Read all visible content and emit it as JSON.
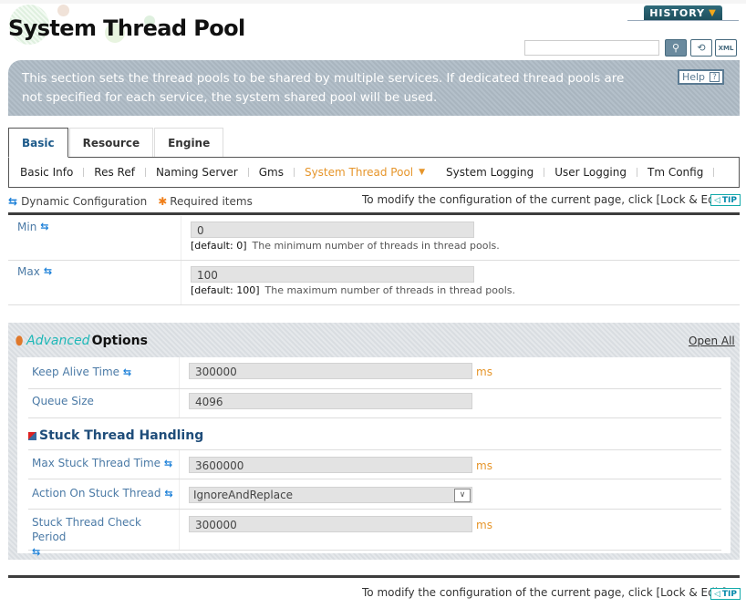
{
  "header": {
    "title": "System Thread Pool",
    "history_label": "HISTORY",
    "search_placeholder": "",
    "search_icon": "search-icon",
    "refresh_icon": "refresh-icon",
    "xml_icon": "xml-export-icon",
    "xml_label": "XML"
  },
  "banner": {
    "text": "This section sets the thread pools to be shared by multiple services. If dedicated thread pools are not specified for each service, the system shared pool will be used.",
    "help_label": "Help",
    "help_glyph": "?"
  },
  "tabs": [
    {
      "label": "Basic",
      "active": true
    },
    {
      "label": "Resource",
      "active": false
    },
    {
      "label": "Engine",
      "active": false
    }
  ],
  "subnav": [
    {
      "label": "Basic Info"
    },
    {
      "label": "Res Ref"
    },
    {
      "label": "Naming Server"
    },
    {
      "label": "Gms"
    },
    {
      "label": "System Thread Pool",
      "active": true
    },
    {
      "label": "System Logging"
    },
    {
      "label": "User Logging"
    },
    {
      "label": "Tm Config"
    }
  ],
  "legend": {
    "dynamic": "Dynamic Configuration",
    "required": "Required items"
  },
  "tip": {
    "text": "To modify the configuration of the current page, click [Lock & Edit].",
    "badge": "TIP"
  },
  "basic_fields": [
    {
      "label": "Min",
      "value": "0",
      "default": "[default: 0]",
      "description": "The minimum number of threads in thread pools."
    },
    {
      "label": "Max",
      "value": "100",
      "default": "[default: 100]",
      "description": "The maximum number of threads in thread pools."
    }
  ],
  "advanced": {
    "title_em": "Advanced",
    "title": "Options",
    "open_all": "Open All",
    "fields": [
      {
        "label": "Keep Alive Time",
        "value": "300000",
        "unit": "ms"
      },
      {
        "label": "Queue Size",
        "value": "4096"
      }
    ],
    "stuck": {
      "heading": "Stuck Thread Handling",
      "fields": [
        {
          "label": "Max Stuck Thread Time",
          "value": "3600000",
          "unit": "ms"
        },
        {
          "label": "Action On Stuck Thread",
          "value": "IgnoreAndReplace"
        },
        {
          "label": "Stuck Thread Check Period",
          "value": "300000",
          "unit": "ms"
        }
      ]
    }
  }
}
